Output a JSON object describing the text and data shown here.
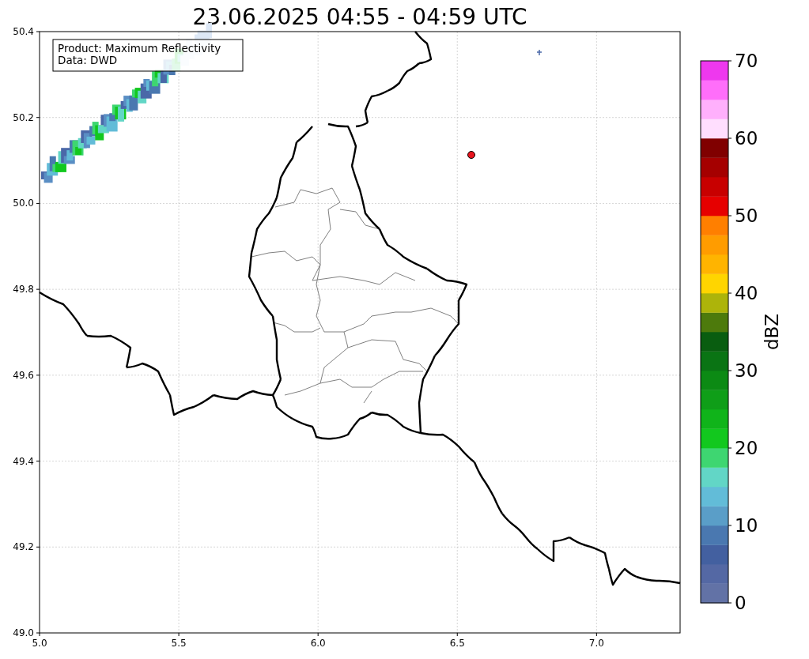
{
  "title": "23.06.2025 04:55 - 04:59 UTC",
  "map": {
    "annotation": [
      "Product: Maximum Reflectivity",
      "Data: DWD"
    ],
    "xticks": [
      "5.0",
      "5.5",
      "6.0",
      "6.5",
      "7.0"
    ],
    "yticks": [
      "50.4",
      "50.2",
      "50.0",
      "49.8",
      "49.6",
      "49.4",
      "49.2",
      "49.0"
    ]
  },
  "colorbar": {
    "label": "dBZ",
    "ticks": [
      "70",
      "60",
      "50",
      "40",
      "30",
      "20",
      "10",
      "0"
    ],
    "bands": [
      {
        "color": "#6272a6"
      },
      {
        "color": "#5468a4"
      },
      {
        "color": "#4360a0"
      },
      {
        "color": "#4a78b0"
      },
      {
        "color": "#5a9ec8"
      },
      {
        "color": "#62bcd8"
      },
      {
        "color": "#62d6c6"
      },
      {
        "color": "#3ed671"
      },
      {
        "color": "#12c81e"
      },
      {
        "color": "#10b41a"
      },
      {
        "color": "#0f9e18"
      },
      {
        "color": "#0c8a14"
      },
      {
        "color": "#0a7414"
      },
      {
        "color": "#095d10"
      },
      {
        "color": "#4d7a0c"
      },
      {
        "color": "#adb40a"
      },
      {
        "color": "#ffd500"
      },
      {
        "color": "#ffb400"
      },
      {
        "color": "#ff9c00"
      },
      {
        "color": "#ff7f00"
      },
      {
        "color": "#e60000"
      },
      {
        "color": "#c80000"
      },
      {
        "color": "#a50000"
      },
      {
        "color": "#800000"
      },
      {
        "color": "#ffdefe"
      },
      {
        "color": "#ffb0fc"
      },
      {
        "color": "#ff6efa"
      },
      {
        "color": "#ee38ee"
      }
    ]
  }
}
